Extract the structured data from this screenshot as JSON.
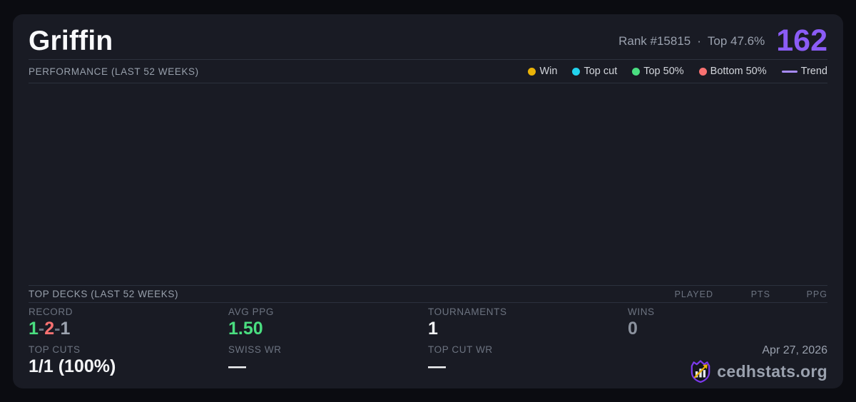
{
  "player": {
    "name": "Griffin",
    "rank": "Rank #15815",
    "separator": "·",
    "top_percent": "Top 47.6%",
    "score": "162"
  },
  "performance": {
    "title": "PERFORMANCE (LAST 52 WEEKS)",
    "legend": [
      {
        "label": "Win",
        "color": "#eab308",
        "marker": "dot"
      },
      {
        "label": "Top cut",
        "color": "#22d3ee",
        "marker": "dot"
      },
      {
        "label": "Top 50%",
        "color": "#4ade80",
        "marker": "dot"
      },
      {
        "label": "Bottom 50%",
        "color": "#f87171",
        "marker": "dot"
      },
      {
        "label": "Trend",
        "color": "#a78bfa",
        "marker": "line"
      }
    ]
  },
  "chart_data": {
    "type": "scatter",
    "title": "PERFORMANCE (LAST 52 WEEKS)",
    "x": [],
    "series": [
      {
        "name": "Win",
        "color": "#eab308",
        "points": []
      },
      {
        "name": "Top cut",
        "color": "#22d3ee",
        "points": []
      },
      {
        "name": "Top 50%",
        "color": "#4ade80",
        "points": []
      },
      {
        "name": "Bottom 50%",
        "color": "#f87171",
        "points": []
      },
      {
        "name": "Trend",
        "color": "#a78bfa",
        "points": []
      }
    ],
    "legend_position": "top-right",
    "grid": false,
    "axes_visible": false,
    "note": "Chart plot area is rendered empty in the screenshot — no points, lines or axes are visible."
  },
  "decks": {
    "title": "TOP DECKS (LAST 52 WEEKS)",
    "columns": [
      "PLAYED",
      "PTS",
      "PPG"
    ],
    "rows": []
  },
  "stats": {
    "record": {
      "label": "RECORD",
      "wins": "1",
      "losses": "2",
      "draws": "1",
      "sep": "-"
    },
    "avg_ppg": {
      "label": "AVG PPG",
      "value": "1.50"
    },
    "tournaments": {
      "label": "TOURNAMENTS",
      "value": "1"
    },
    "wins": {
      "label": "WINS",
      "value": "0"
    },
    "top_cuts": {
      "label": "TOP CUTS",
      "value": "1/1 (100%)"
    },
    "swiss_wr": {
      "label": "SWISS WR",
      "value": "—"
    },
    "top_cut_wr": {
      "label": "TOP CUT WR",
      "value": "—"
    }
  },
  "footer": {
    "date": "Apr 27, 2026",
    "brand": "cedhstats.org"
  },
  "colors": {
    "accent_purple": "#8b5cf6",
    "trend_purple": "#a78bfa",
    "win_yellow": "#eab308",
    "top_cut_cyan": "#22d3ee",
    "positive_green": "#4ade80",
    "negative_red": "#f87171",
    "card_bg": "#191b24",
    "page_bg": "#0b0c11"
  }
}
